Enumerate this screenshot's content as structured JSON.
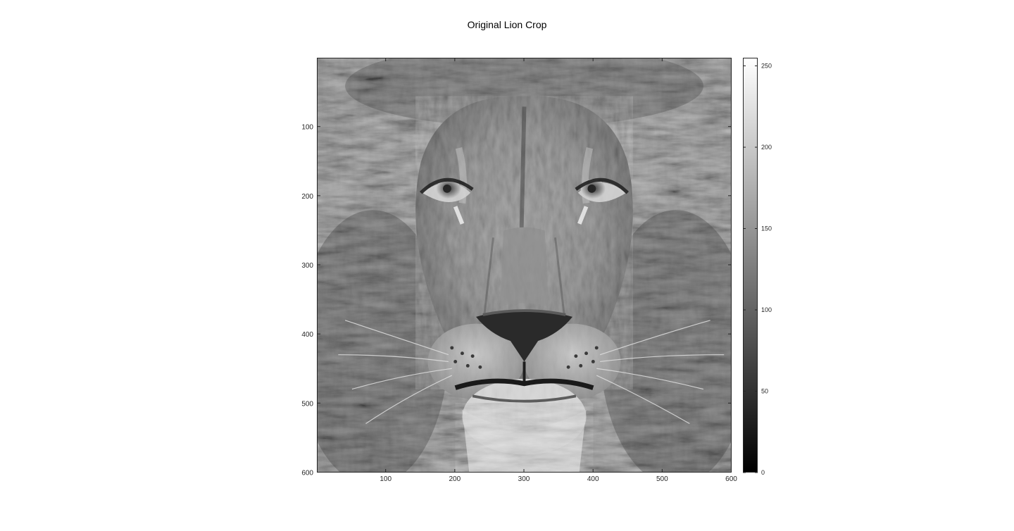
{
  "chart_data": {
    "type": "heatmap",
    "title": "Original Lion Crop",
    "colormap": "gray",
    "image_extent": {
      "x": [
        0.5,
        600.5
      ],
      "y": [
        0.5,
        600.5
      ]
    },
    "y_axis_direction": "reversed",
    "xticks": [
      100,
      200,
      300,
      400,
      500,
      600
    ],
    "yticks": [
      100,
      200,
      300,
      400,
      500,
      600
    ],
    "colorbar": {
      "limits": [
        0,
        255
      ],
      "ticks": [
        0,
        50,
        100,
        150,
        200,
        250
      ]
    },
    "grid": false,
    "xlabel": "",
    "ylabel": ""
  }
}
